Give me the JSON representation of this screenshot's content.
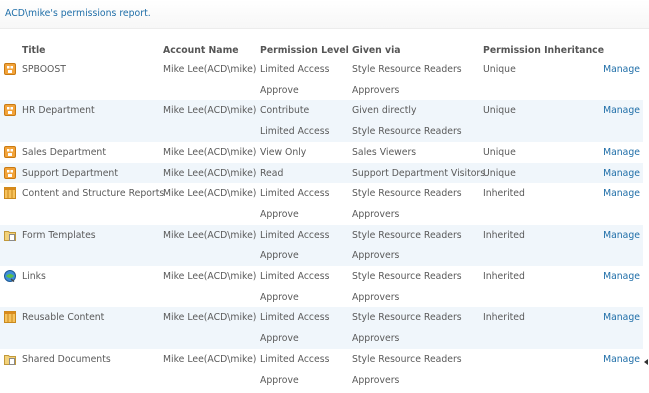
{
  "report": {
    "title": "ACD\\mike's permissions report."
  },
  "columns": [
    "Title",
    "Account Name",
    "Permission Level",
    "Given via",
    "Permission Inheritance"
  ],
  "rows": [
    {
      "icon": "site-icon",
      "title": "SPBOOST",
      "account": "Mike Lee(ACD\\mike)",
      "levels": [
        "Limited Access",
        "Approve"
      ],
      "via": [
        "Style Resource Readers",
        "Approvers"
      ],
      "inheritance": "Unique",
      "action": "Manage"
    },
    {
      "icon": "site-icon",
      "title": "HR Department",
      "account": "Mike Lee(ACD\\mike)",
      "levels": [
        "Contribute",
        "Limited Access"
      ],
      "via": [
        "Given directly",
        "Style Resource Readers"
      ],
      "inheritance": "Unique",
      "action": "Manage"
    },
    {
      "icon": "site-icon",
      "title": "Sales Department",
      "account": "Mike Lee(ACD\\mike)",
      "levels": [
        "View Only"
      ],
      "via": [
        "Sales Viewers"
      ],
      "inheritance": "Unique",
      "action": "Manage"
    },
    {
      "icon": "site-icon",
      "title": "Support Department",
      "account": "Mike Lee(ACD\\mike)",
      "levels": [
        "Read"
      ],
      "via": [
        "Support Department Visitors"
      ],
      "inheritance": "Unique",
      "action": "Manage"
    },
    {
      "icon": "list-icon",
      "title": "Content and Structure Reports",
      "account": "Mike Lee(ACD\\mike)",
      "levels": [
        "Limited Access",
        "Approve"
      ],
      "via": [
        "Style Resource Readers",
        "Approvers"
      ],
      "inheritance": "Inherited",
      "action": "Manage"
    },
    {
      "icon": "doclib-icon",
      "title": "Form Templates",
      "account": "Mike Lee(ACD\\mike)",
      "levels": [
        "Limited Access",
        "Approve"
      ],
      "via": [
        "Style Resource Readers",
        "Approvers"
      ],
      "inheritance": "Inherited",
      "action": "Manage"
    },
    {
      "icon": "links-icon",
      "title": "Links",
      "account": "Mike Lee(ACD\\mike)",
      "levels": [
        "Limited Access",
        "Approve"
      ],
      "via": [
        "Style Resource Readers",
        "Approvers"
      ],
      "inheritance": "Inherited",
      "action": "Manage"
    },
    {
      "icon": "list-icon",
      "title": "Reusable Content",
      "account": "Mike Lee(ACD\\mike)",
      "levels": [
        "Limited Access",
        "Approve"
      ],
      "via": [
        "Style Resource Readers",
        "Approvers"
      ],
      "inheritance": "Inherited",
      "action": "Manage"
    },
    {
      "icon": "doclib-icon",
      "title": "Shared Documents",
      "account": "Mike Lee(ACD\\mike)",
      "levels": [
        "Limited Access",
        "Approve"
      ],
      "via": [
        "Style Resource Readers",
        "Approvers"
      ],
      "inheritance": "",
      "action": "Manage"
    }
  ],
  "colors": {
    "link": "#1f6ea8",
    "row_alt": "#f0f6fb",
    "site_icon": "#f2a33a"
  }
}
